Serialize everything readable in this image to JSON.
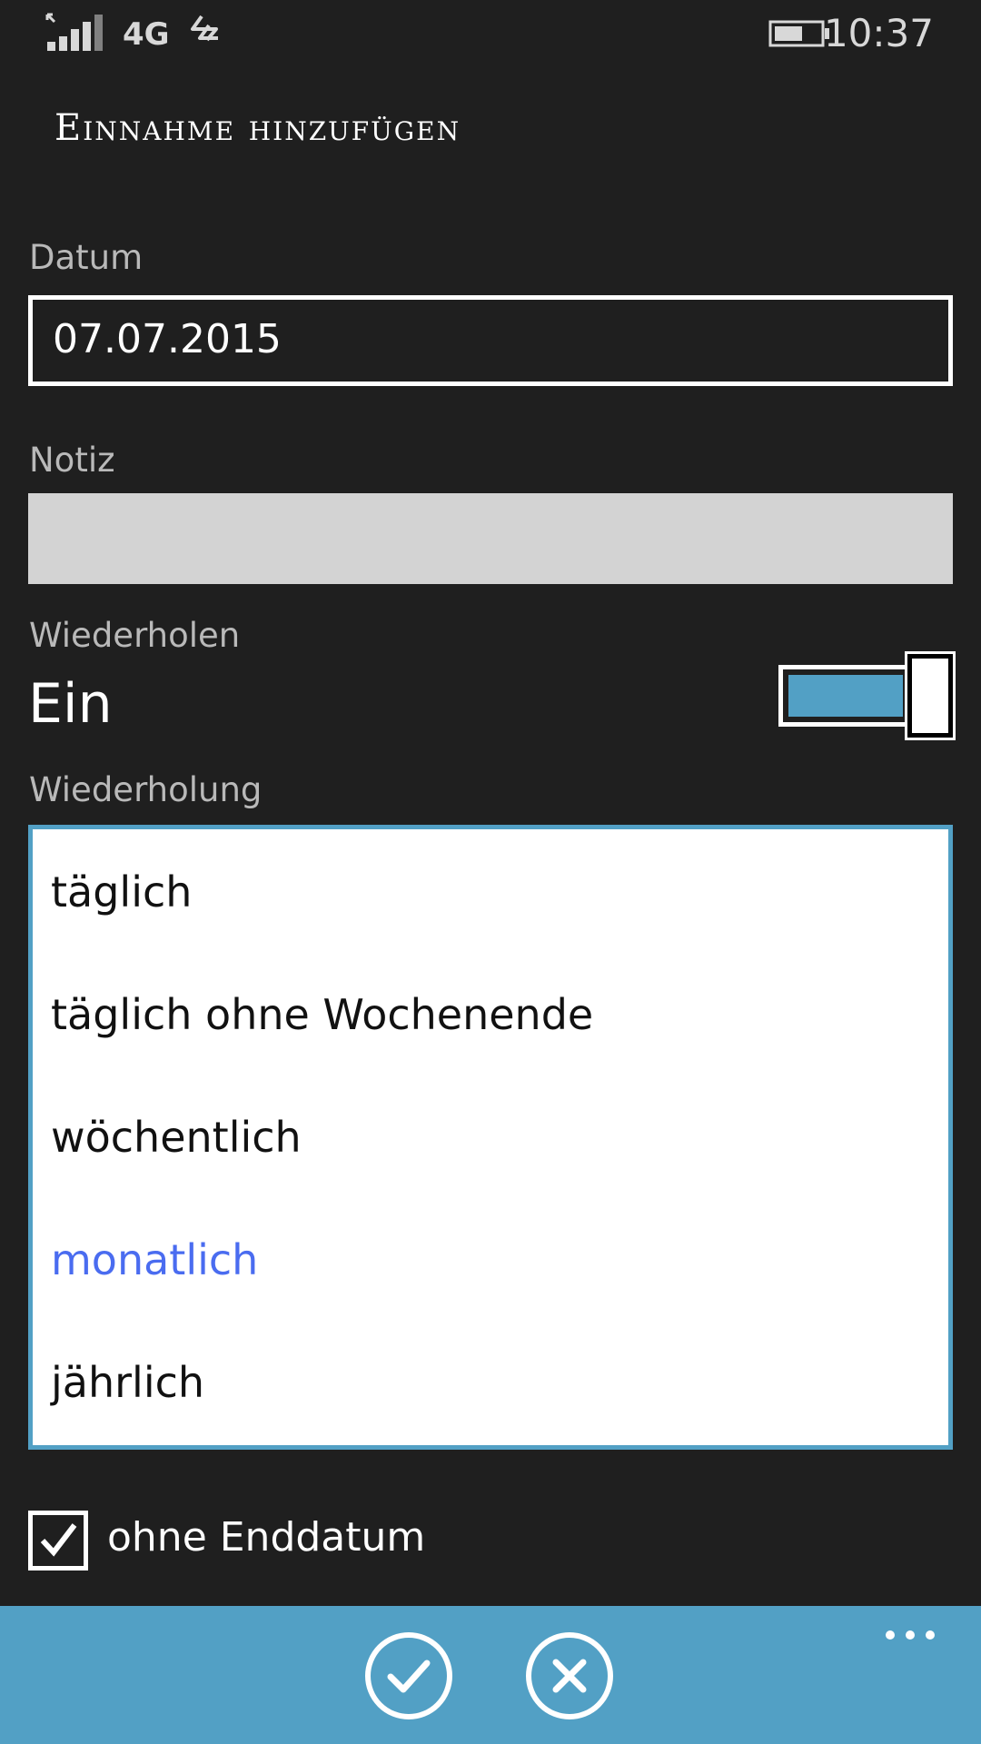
{
  "status_bar": {
    "network": "4G",
    "time": "10:37",
    "icons": [
      "signal-icon",
      "data-transfer-icon",
      "battery-icon"
    ]
  },
  "page": {
    "title": "Einnahme hinzufügen"
  },
  "form": {
    "date_label": "Datum",
    "date_value": "07.07.2015",
    "note_label": "Notiz",
    "note_value": "",
    "repeat_label": "Wiederholen",
    "repeat_state": "Ein",
    "repeat_on": true,
    "recurrence_label": "Wiederholung",
    "recurrence_options": [
      "täglich",
      "täglich ohne Wochenende",
      "wöchentlich",
      "monatlich",
      "jährlich"
    ],
    "recurrence_selected": "monatlich",
    "no_end_date_label": "ohne Enddatum",
    "no_end_date_checked": true
  },
  "app_bar": {
    "buttons": [
      "check-icon",
      "close-icon"
    ],
    "more": "more-icon"
  },
  "colors": {
    "accent": "#52a0c5",
    "background": "#1f1f1f",
    "selected_item": "#4a6cf0"
  }
}
